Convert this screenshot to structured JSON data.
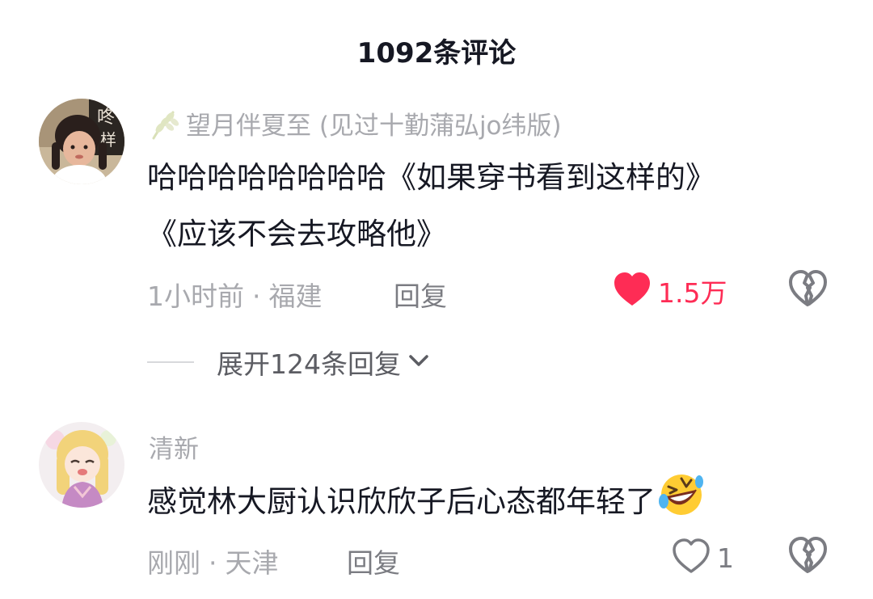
{
  "header": {
    "title": "1092条评论"
  },
  "comments": [
    {
      "username": "望月伴夏至 (见过十勤蒲弘jo纬版)",
      "text_line1": "哈哈哈哈哈哈哈哈《如果穿书看到这样的》",
      "text_line2": "《应该不会去攻略他》",
      "time": "1小时前",
      "dot": "·",
      "location": "福建",
      "reply_label": "回复",
      "like_count": "1.5万",
      "liked": true,
      "expand_label": "展开124条回复"
    },
    {
      "username": "清新",
      "text_line1": "感觉林大厨认识欣欣子后心态都年轻了",
      "time": "刚刚",
      "dot": "·",
      "location": "天津",
      "reply_label": "回复",
      "like_count": "1",
      "liked": false
    }
  ],
  "colors": {
    "like_active": "#fe2c55",
    "secondary_text": "#a8a9ae",
    "primary_text": "#161823"
  }
}
